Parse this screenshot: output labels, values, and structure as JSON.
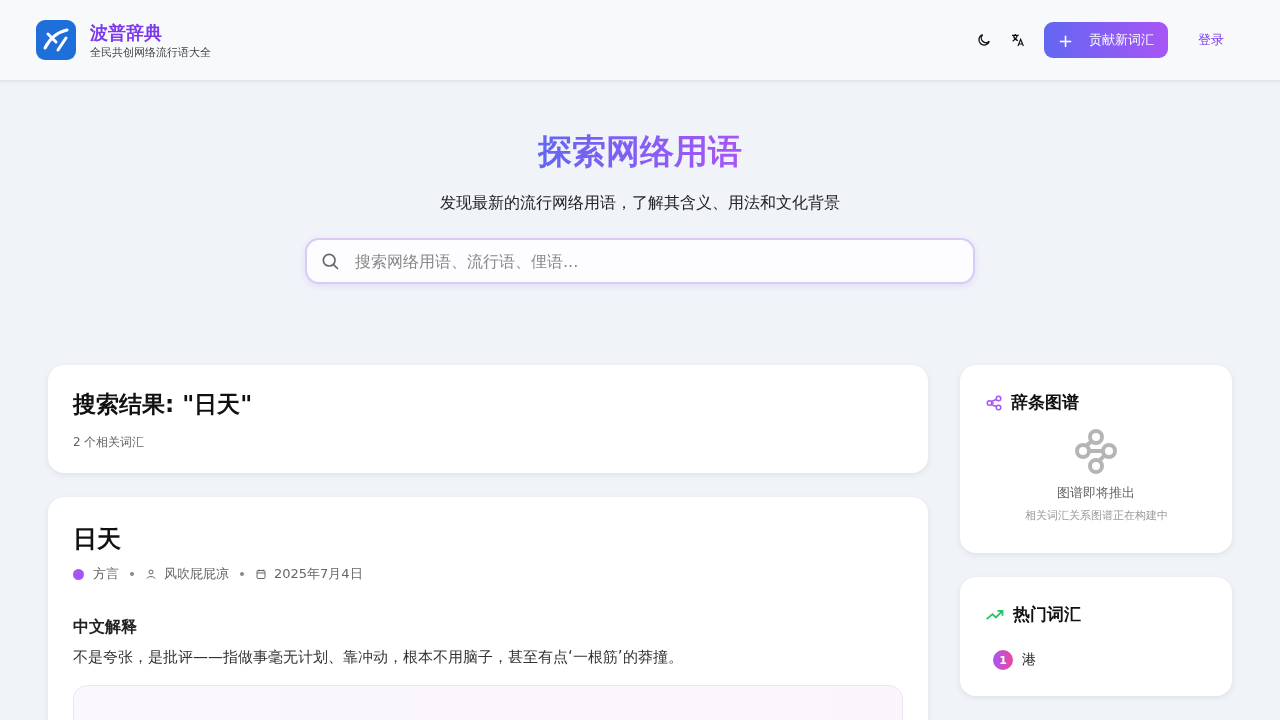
{
  "header": {
    "logo_title": "波普辞典",
    "logo_subtitle": "全民共创网络流行语大全",
    "contribute_button": "贡献新词汇",
    "contribute_icon": "+",
    "login_link": "登录"
  },
  "hero": {
    "title": "探索网络用语",
    "subtitle": "发现最新的流行网络用语，了解其含义、用法和文化背景",
    "search": {
      "placeholder": "搜索网络用语、流行语、俚语..."
    }
  },
  "results": {
    "title": "搜索结果: \"日天\"",
    "count": "2 个相关词汇"
  },
  "entries": [
    {
      "word": "日天",
      "category": "方言",
      "color": "#a855f7",
      "author": "风吹屁屁凉",
      "date": "2025年7月4日",
      "chinese_heading": "中文解释",
      "chinese_text": "不是夸张，是批评——指做事毫无计划、靠冲动，根本不用脑子，甚至有点‘一根筋’的莽撞。"
    }
  ],
  "graph_card": {
    "title": "辞条图谱",
    "status": "图谱即将推出",
    "note": "相关词汇关系图谱正在构建中"
  },
  "trending": {
    "title": "热门词汇",
    "items": [
      {
        "rank": "1",
        "word": "港"
      }
    ]
  }
}
